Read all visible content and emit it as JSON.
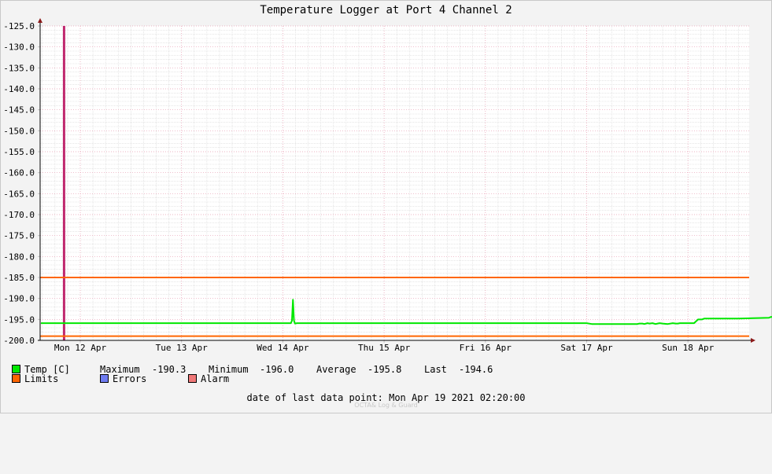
{
  "chart_data": {
    "type": "line",
    "title": "Temperature Logger at Port 4 Channel 2",
    "ylim": [
      -200.0,
      -125.0
    ],
    "yticks": [
      "-125.0",
      "-130.0",
      "-135.0",
      "-140.0",
      "-145.0",
      "-150.0",
      "-155.0",
      "-160.0",
      "-165.0",
      "-170.0",
      "-175.0",
      "-180.0",
      "-185.0",
      "-190.0",
      "-195.0",
      "-200.0"
    ],
    "xticks": [
      "Mon 12 Apr",
      "Tue 13 Apr",
      "Wed 14 Apr",
      "Thu 15 Apr",
      "Fri 16 Apr",
      "Sat 17 Apr",
      "Sun 18 Apr"
    ],
    "grid": true,
    "series": [
      {
        "name": "Temp [C]",
        "color": "#00e800",
        "x": [
          0,
          2.08,
          2.09,
          2.1,
          2.11,
          2.12,
          2.14,
          2.16,
          2.3,
          4.5,
          5.0,
          5.05,
          5.5,
          5.52,
          5.55,
          5.57,
          5.6,
          5.62,
          5.65,
          5.68,
          5.7,
          5.72,
          5.75,
          5.8,
          5.85,
          5.88,
          5.9,
          5.92,
          6.0,
          6.06,
          6.1,
          6.14,
          6.16,
          6.2,
          6.5,
          6.8,
          6.82,
          6.9
        ],
        "y": [
          -195.9,
          -195.9,
          -195.3,
          -190.3,
          -195.3,
          -196.0,
          -195.9,
          -195.9,
          -195.9,
          -195.9,
          -195.9,
          -196.1,
          -196.1,
          -196.0,
          -196.0,
          -196.1,
          -195.9,
          -196.0,
          -195.9,
          -196.1,
          -196.0,
          -195.9,
          -196.0,
          -196.1,
          -195.9,
          -196.0,
          -196.0,
          -195.9,
          -195.9,
          -195.9,
          -195.0,
          -195.0,
          -194.8,
          -194.8,
          -194.8,
          -194.6,
          -194.4,
          -194.5
        ]
      }
    ],
    "limits": {
      "name": "Limits",
      "color": "#ff6600",
      "values": [
        -185.0,
        -199.0
      ]
    },
    "marker": {
      "color": "#c0286e",
      "x": -0.16
    }
  },
  "legend": {
    "temp_label": "Temp [C]",
    "limits_label": "Limits",
    "errors_label": "Errors",
    "alarm_label": "Alarm",
    "temp_color": "#00e800",
    "limits_color": "#ff6600",
    "errors_color": "#6f7cf0",
    "alarm_color": "#f07878"
  },
  "stats": {
    "maximum_label": "Maximum",
    "maximum_value": "-190.3",
    "minimum_label": "Minimum",
    "minimum_value": "-196.0",
    "average_label": "Average",
    "average_value": "-195.8",
    "last_label": "Last",
    "last_value": "-194.6"
  },
  "footer": {
    "last_point_label": "date of last data point:",
    "last_point_value": "Mon Apr 19 2021 02:20:00",
    "watermark": "OCTA& Log & Guard"
  }
}
